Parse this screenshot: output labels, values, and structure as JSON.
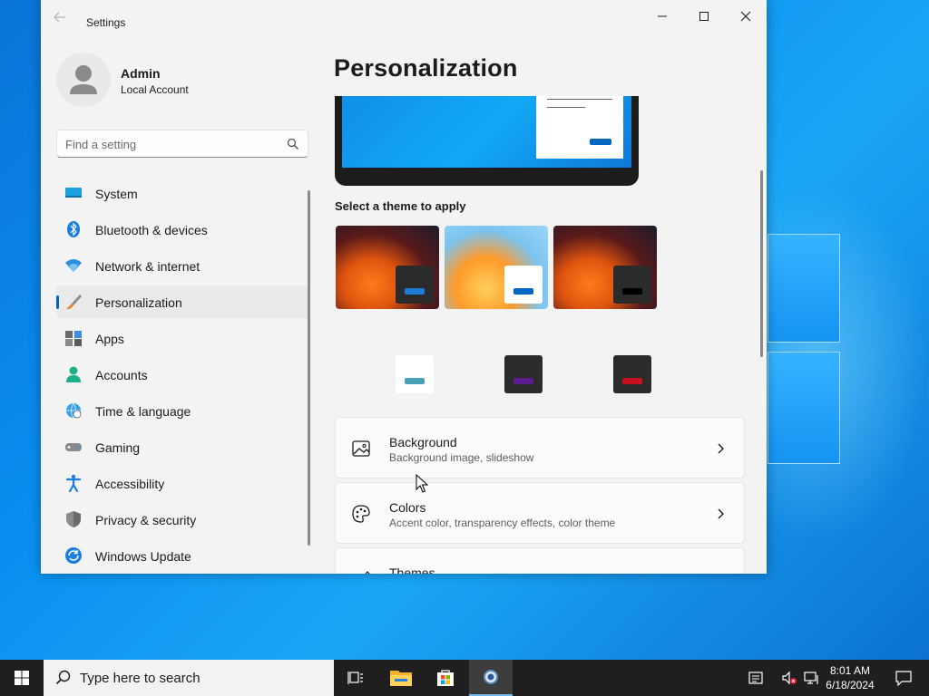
{
  "window": {
    "title": "Settings",
    "controls": [
      "minimize-icon",
      "maximize-icon",
      "close-icon"
    ]
  },
  "profile": {
    "name": "Admin",
    "account_type": "Local Account"
  },
  "search": {
    "placeholder": "Find a setting"
  },
  "sidebar": {
    "items": [
      {
        "label": "System",
        "icon": "system-icon"
      },
      {
        "label": "Bluetooth & devices",
        "icon": "bluetooth-icon"
      },
      {
        "label": "Network & internet",
        "icon": "wifi-icon"
      },
      {
        "label": "Personalization",
        "icon": "brush-icon",
        "active": true
      },
      {
        "label": "Apps",
        "icon": "apps-icon"
      },
      {
        "label": "Accounts",
        "icon": "accounts-icon"
      },
      {
        "label": "Time & language",
        "icon": "globe-clock-icon"
      },
      {
        "label": "Gaming",
        "icon": "gamepad-icon"
      },
      {
        "label": "Accessibility",
        "icon": "accessibility-icon"
      },
      {
        "label": "Privacy & security",
        "icon": "shield-icon"
      },
      {
        "label": "Windows Update",
        "icon": "update-icon"
      }
    ]
  },
  "main": {
    "page_title": "Personalization",
    "themes_label": "Select a theme to apply",
    "settings_cards": [
      {
        "title": "Background",
        "subtitle": "Background image, slideshow",
        "icon": "image-icon"
      },
      {
        "title": "Colors",
        "subtitle": "Accent color, transparency effects, color theme",
        "icon": "palette-icon"
      },
      {
        "title": "Themes",
        "subtitle": "",
        "icon": "brush-icon"
      }
    ]
  },
  "colors": {
    "accent": "#0067c0",
    "theme_accents": [
      "#1f7ad6",
      "#0067c0",
      "#000000",
      "#4a9fb8",
      "#5b1d8f",
      "#c8101e"
    ]
  },
  "taskbar": {
    "search_placeholder": "Type here to search",
    "apps": [
      "task-view-icon",
      "file-explorer-icon",
      "store-icon",
      "settings-icon"
    ],
    "clock_time": "8:01 AM",
    "clock_date": "6/18/2024"
  }
}
